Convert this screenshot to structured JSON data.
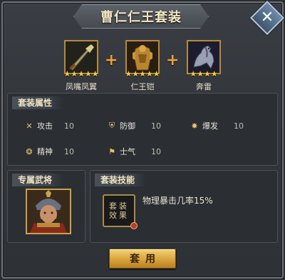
{
  "dialog": {
    "title": "曹仁仁王套装",
    "close_label": "✕"
  },
  "items": [
    {
      "name": "凤嘴凤翼",
      "stars": "★★★★★",
      "icon": "sword-icon"
    },
    {
      "name": "仁王铠",
      "stars": "★★★★★",
      "icon": "armor-icon"
    },
    {
      "name": "奔雷",
      "stars": "★★★★",
      "icon": "horse-icon"
    }
  ],
  "plus_sign": "+",
  "attributes": {
    "label": "套装属性",
    "list": [
      {
        "name": "攻击",
        "value": "10",
        "icon": "attack-icon"
      },
      {
        "name": "防御",
        "value": "10",
        "icon": "defense-icon"
      },
      {
        "name": "爆发",
        "value": "10",
        "icon": "burst-icon"
      },
      {
        "name": "精神",
        "value": "10",
        "icon": "spirit-icon"
      },
      {
        "name": "士气",
        "value": "10",
        "icon": "morale-icon"
      }
    ]
  },
  "general": {
    "label": "专属武将"
  },
  "skill": {
    "label": "套装技能",
    "icon_line1": "套装",
    "icon_line2": "效果",
    "description": "物理暴击几率15%"
  },
  "use_button": "套用",
  "colors": {
    "accent_gold": "#d9a33d",
    "star": "#f2c94c",
    "frame_gold": "#b48a3c"
  }
}
